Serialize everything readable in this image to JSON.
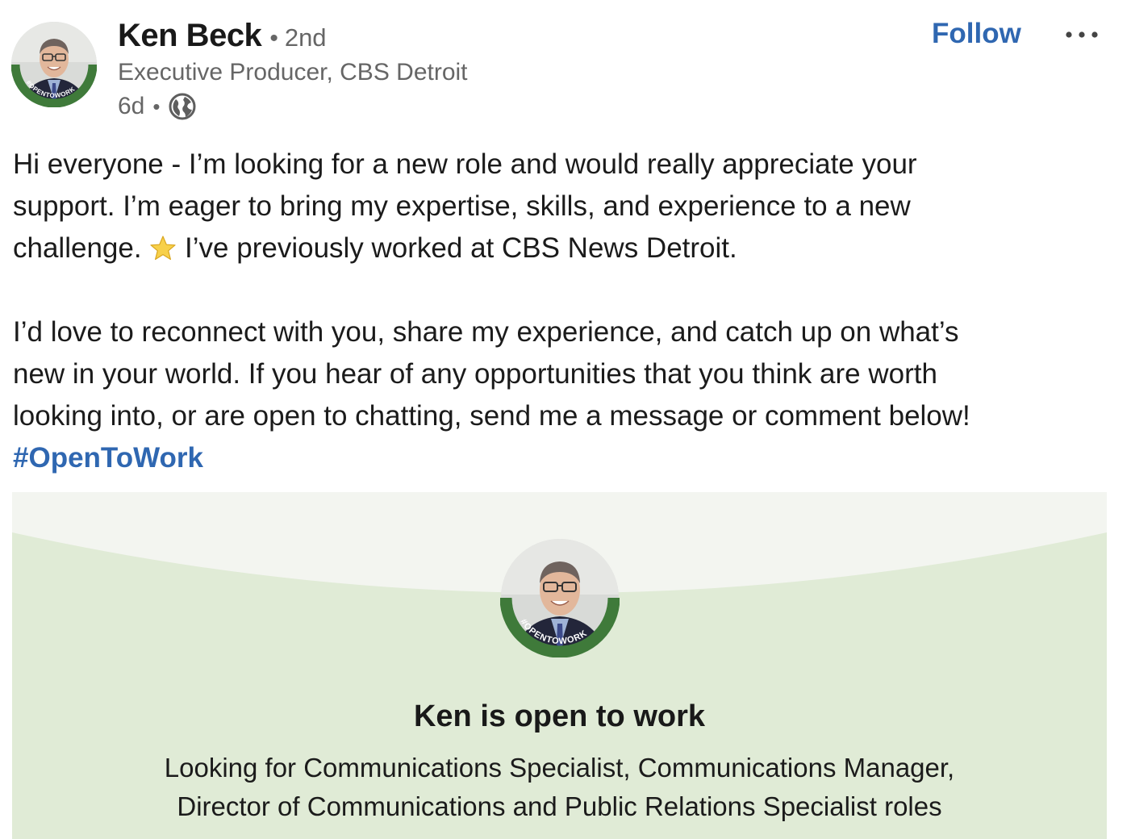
{
  "post": {
    "author": {
      "name": "Ken Beck",
      "separator": "•",
      "degree": "2nd",
      "headline": "Executive Producer, CBS Detroit",
      "time": "6d",
      "visibility_icon": "globe-icon",
      "badge_text": "#OPENTOWORK"
    },
    "actions": {
      "follow_label": "Follow",
      "more_icon": "ellipsis-icon"
    },
    "body": {
      "line1": "Hi everyone - I’m looking for a new role and would really appreciate your",
      "line2": "support. I’m eager to bring my expertise, skills, and experience to a new",
      "line3_a": "challenge.",
      "star_icon": "star-emoji-icon",
      "line3_b": "I’ve previously worked at CBS News Detroit.",
      "line4": "I’d love to reconnect with you, share my experience, and catch up on what’s",
      "line5": "new in your world. If you hear of any opportunities that you think are worth",
      "line6": "looking into, or are open to chatting, send me a message or comment below!",
      "hashtag": "#OpenToWork"
    },
    "open_to_work_card": {
      "title": "Ken is open to work",
      "subtitle_line1": "Looking for Communications Specialist, Communications Manager,",
      "subtitle_line2": "Director of Communications and Public Relations Specialist roles",
      "badge_text": "#OPENTOWORK",
      "background_color": "#e0ebd6"
    },
    "colors": {
      "link": "#2f67b1",
      "muted_text": "#666666",
      "badge_green": "#3f7a3a"
    }
  }
}
